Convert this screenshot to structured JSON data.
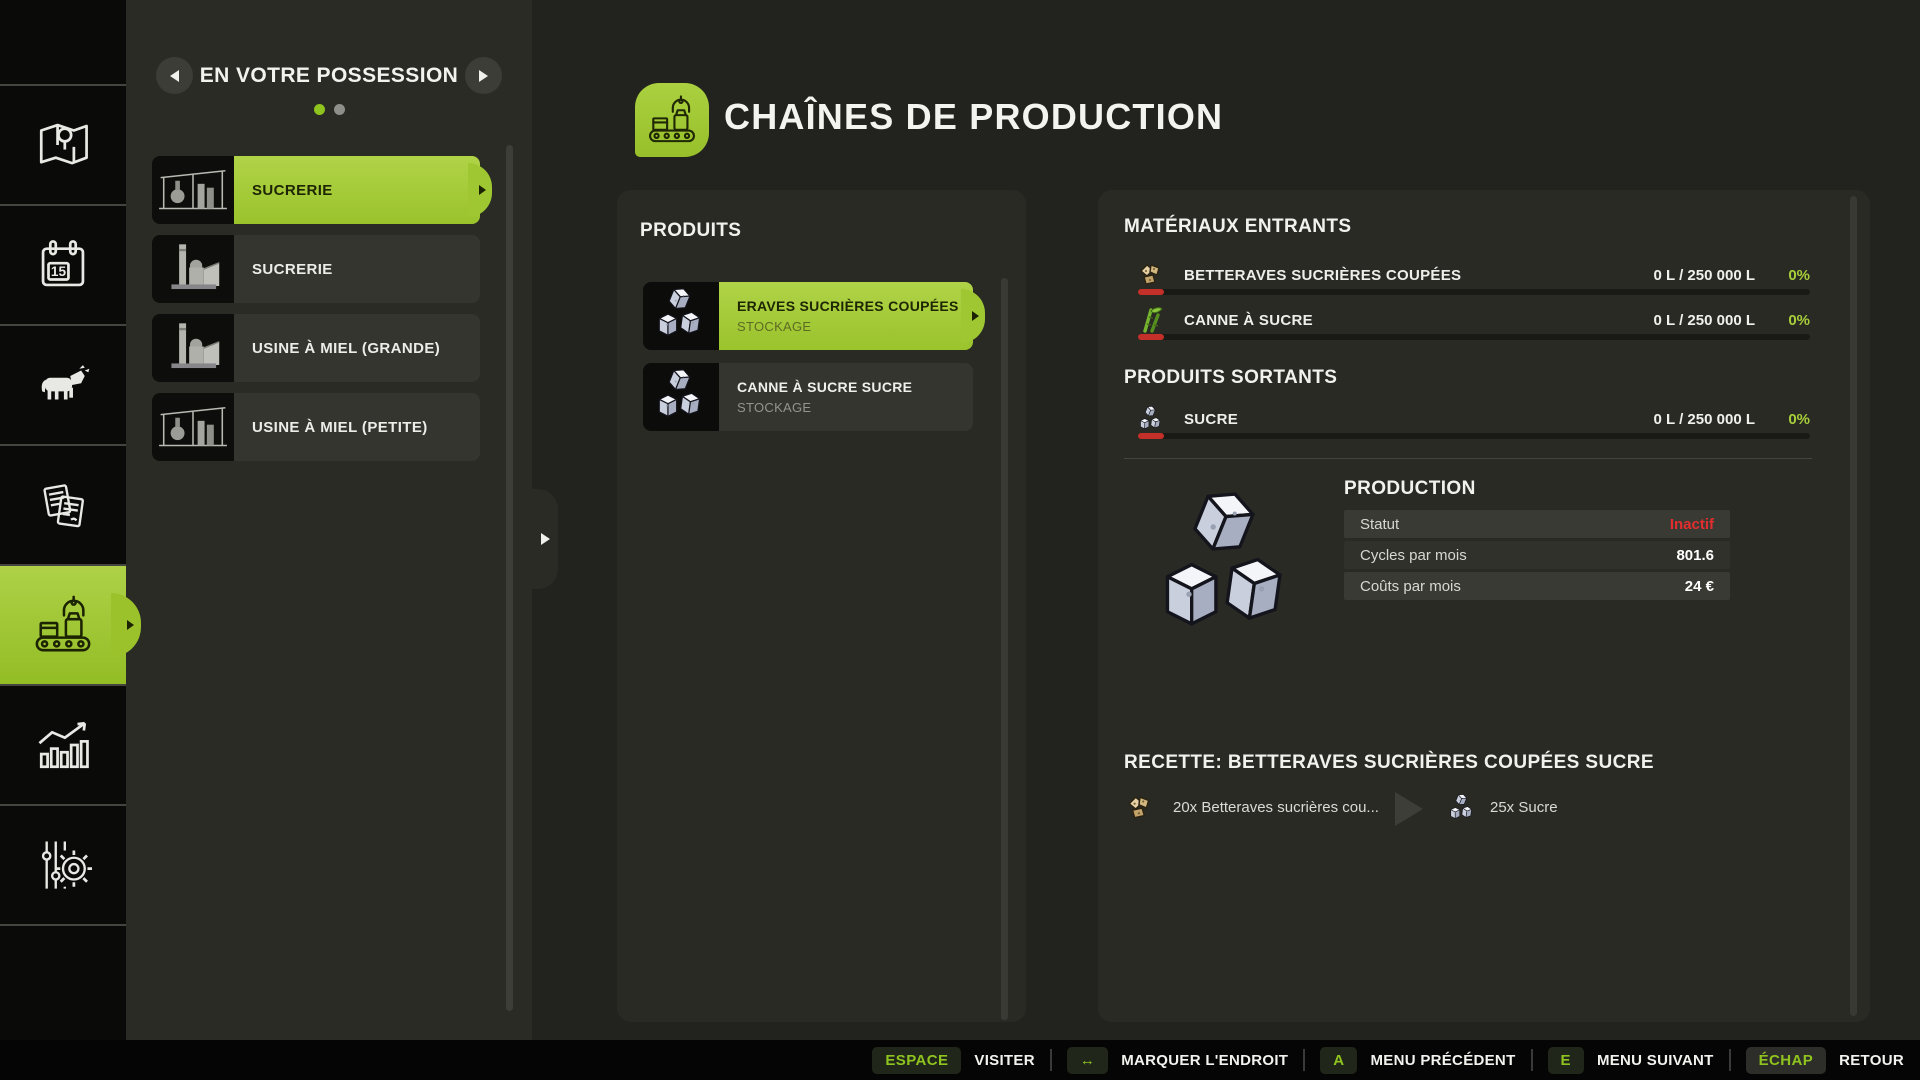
{
  "colors": {
    "accent": "#a4cc37",
    "danger": "#e22e2e"
  },
  "sidebar": {
    "calendar_day": "15",
    "icons": [
      "map",
      "calendar",
      "animals",
      "contracts",
      "production",
      "statistics",
      "settings"
    ],
    "active": "production"
  },
  "left_panel": {
    "title": "EN VOTRE POSSESSION",
    "page_dots": 2,
    "active_dot": 1,
    "factories": [
      {
        "label": "SUCRERIE",
        "selected": true
      },
      {
        "label": "SUCRERIE",
        "selected": false
      },
      {
        "label": "USINE À MIEL (GRANDE)",
        "selected": false
      },
      {
        "label": "USINE À MIEL (PETITE)",
        "selected": false
      }
    ]
  },
  "header": {
    "title": "CHAÎNES DE PRODUCTION",
    "icon": "production-chain"
  },
  "products_panel": {
    "title": "PRODUITS",
    "items": [
      {
        "title": "ERAVES SUCRIÈRES COUPÉES",
        "subtitle": "STOCKAGE",
        "selected": true,
        "icon": "sugar-cubes"
      },
      {
        "title": "CANNE À SUCRE SUCRE",
        "subtitle": "STOCKAGE",
        "selected": false,
        "icon": "sugar-cubes"
      }
    ]
  },
  "details": {
    "inputs_title": "MATÉRIAUX ENTRANTS",
    "inputs": [
      {
        "label": "BETTERAVES SUCRIÈRES COUPÉES",
        "amount": "0 L / 250 000 L",
        "fill": "0%",
        "icon": "beet-pieces"
      },
      {
        "label": "CANNE À SUCRE",
        "amount": "0 L / 250 000 L",
        "fill": "0%",
        "icon": "sugar-cane"
      }
    ],
    "outputs_title": "PRODUITS SORTANTS",
    "outputs": [
      {
        "label": "SUCRE",
        "amount": "0 L / 250 000 L",
        "fill": "0%",
        "icon": "sugar-cubes"
      }
    ],
    "production": {
      "title": "PRODUCTION",
      "rows": [
        {
          "label": "Statut",
          "value": "Inactif"
        },
        {
          "label": "Cycles par mois",
          "value": "801.6"
        },
        {
          "label": "Coûts par mois",
          "value": "24 €"
        }
      ]
    },
    "recipe": {
      "title": "RECETTE: BETTERAVES SUCRIÈRES COUPÉES SUCRE",
      "input": "20x Betteraves sucrières cou...",
      "output": "25x Sucre"
    }
  },
  "bottom_bar": {
    "hints": [
      {
        "key": "ESPACE",
        "label": "VISITER"
      },
      {
        "key": "↔",
        "label": "MARQUER L'ENDROIT"
      },
      {
        "key": "A",
        "label": "MENU PRÉCÉDENT"
      },
      {
        "key": "E",
        "label": "MENU SUIVANT"
      },
      {
        "key": "ÉCHAP",
        "label": "RETOUR"
      }
    ]
  }
}
